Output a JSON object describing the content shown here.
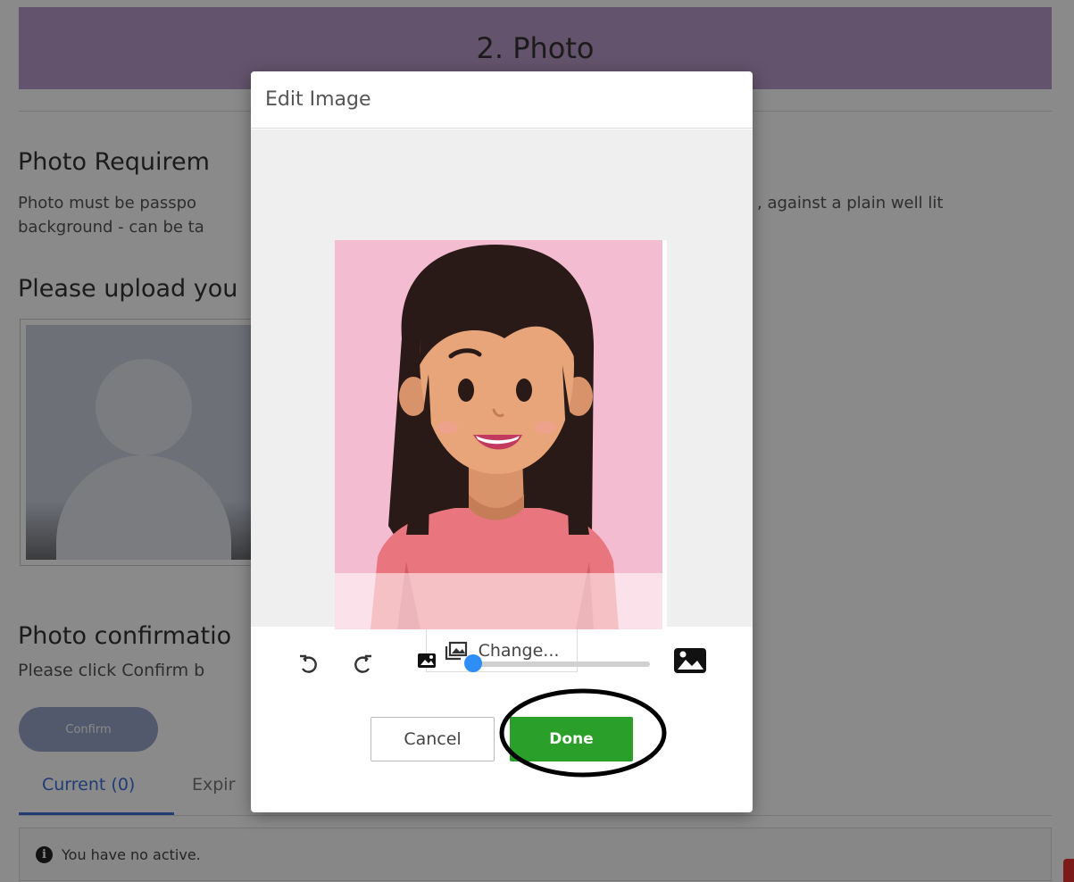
{
  "page": {
    "step_title": "2. Photo",
    "requirements_title": "Photo Requirem",
    "requirements_text_line1": "Photo must be passpo",
    "requirements_text_line1_right": ", against a plain well lit",
    "requirements_text_line2": "background - can be ta",
    "upload_title": "Please upload you",
    "confirm_title": "Photo confirmatio",
    "confirm_text": "Please click Confirm b",
    "confirm_button": "Confirm",
    "tabs": [
      {
        "label": "Current (0)"
      },
      {
        "label": "Expir"
      }
    ],
    "notice": "You have no active."
  },
  "modal": {
    "title": "Edit Image",
    "change_button": "Change...",
    "cancel_button": "Cancel",
    "done_button": "Done",
    "zoom_level": 0
  },
  "colors": {
    "header_bar": "#b89ac7",
    "done_button": "#2aa02a",
    "slider_thumb": "#2f8ef5",
    "tab_active": "#3b6fd6",
    "photo_background": "#f4bcd1"
  },
  "icons": [
    "rotate-left-icon",
    "rotate-right-icon",
    "image-small-icon",
    "image-large-icon",
    "change-image-icon",
    "info-icon"
  ]
}
